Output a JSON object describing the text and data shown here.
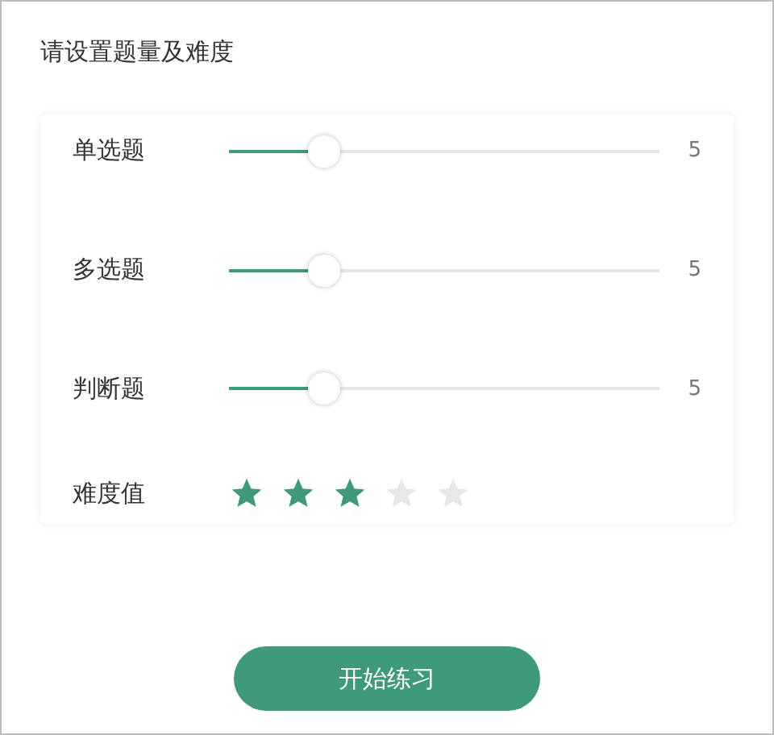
{
  "title": "请设置题量及难度",
  "sliders": [
    {
      "label": "单选题",
      "level": 0.2,
      "reading": "5"
    },
    {
      "label": "多选题",
      "level": 0.2,
      "reading": "5"
    },
    {
      "label": "判断题",
      "level": 0.2,
      "reading": "5"
    }
  ],
  "difficulty": {
    "label": "难度值",
    "stars": 3
  },
  "start_button": "开始练习"
}
